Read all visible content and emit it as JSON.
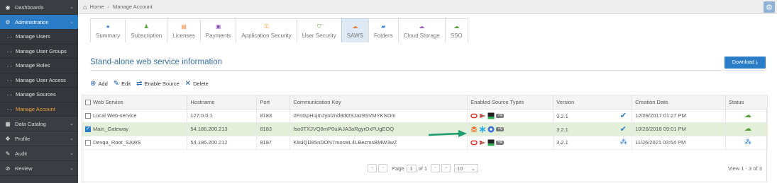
{
  "sidebar": {
    "items": [
      {
        "label": "Dashboards",
        "icon": "dashboard-icon"
      },
      {
        "label": "Administration",
        "icon": "admin-gear-icon"
      },
      {
        "label": "Data Catalog",
        "icon": "catalog-icon"
      },
      {
        "label": "Profile",
        "icon": "profile-icon"
      },
      {
        "label": "Audit",
        "icon": "audit-icon"
      },
      {
        "label": "Review",
        "icon": "review-icon"
      }
    ],
    "sub_items": [
      "Manage Users",
      "Manage User Groups",
      "Manage Roles",
      "Manage User Access",
      "Manage Sources",
      "Manage Account"
    ]
  },
  "breadcrumb": {
    "home": "Home",
    "current": "Manage Account"
  },
  "tabs": [
    {
      "label": "Summary",
      "icon": "●"
    },
    {
      "label": "Subscription",
      "icon": "♟"
    },
    {
      "label": "Licenses",
      "icon": "▤"
    },
    {
      "label": "Payments",
      "icon": "▣"
    },
    {
      "label": "Application Security",
      "icon": "⚿"
    },
    {
      "label": "User Security",
      "icon": "⛉"
    },
    {
      "label": "SAWS",
      "icon": "☁"
    },
    {
      "label": "Folders",
      "icon": "▰"
    },
    {
      "label": "Cloud Storage",
      "icon": "☁"
    },
    {
      "label": "SSO",
      "icon": "☁"
    }
  ],
  "section_title": "Stand-alone web service information",
  "download_label": "Download",
  "toolbar": {
    "add": "Add",
    "edit": "Edit",
    "enable_source": "Enable Source",
    "delete": "Delete"
  },
  "columns": [
    "Web Service",
    "Hostname",
    "Port",
    "Communication Key",
    "Enabled Source Types",
    "Version",
    "Creation Date",
    "Status"
  ],
  "rows": [
    {
      "name": "Local Web-service",
      "host": "127.0.0.1",
      "port": "8183",
      "key": "2FnGpHujmJyolznd8dOSJaz9SVMYKSOm",
      "badge": "+4",
      "version": "3.2.1",
      "date": "12/09/2017 01:27 PM",
      "checked": false
    },
    {
      "name": "Main_Gateway",
      "host": "54.186.200.213",
      "port": "8183",
      "key": "fso0TXJVQ8mP0ulAJA3aRgyrDxFUgEOQ",
      "badge": "+9",
      "version": "3.2.1",
      "date": "10/26/2018 09:01 PM",
      "checked": true
    },
    {
      "name": "Devqa_Root_SAWS",
      "host": "54.186.200.212",
      "port": "8187",
      "key": "KlisIQD85nDON7moswL4LBezmsBMW3wZ",
      "badge": "+4",
      "version": "3.2.1",
      "date": "11/26/2021 03:54 PM",
      "checked": false
    }
  ],
  "pager": {
    "page_label": "Page",
    "page": "1",
    "of_label": "of 1",
    "page_size": "10"
  },
  "view_count": "View 1 - 3 of 3",
  "colors": {
    "accent": "#2a7cc7",
    "sidebar": "#3a3d42",
    "selected_row": "#e4efd9",
    "arrow": "#1a9c6e"
  }
}
